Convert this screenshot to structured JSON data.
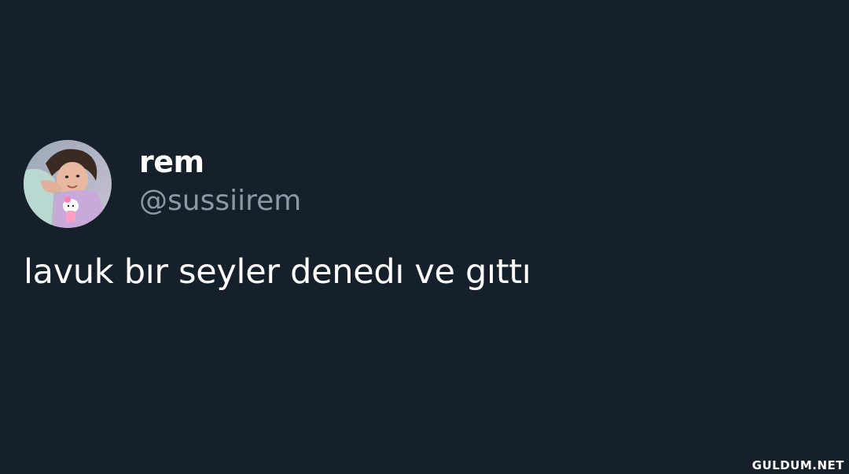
{
  "tweet": {
    "display_name": "rem",
    "handle": "@sussiirem",
    "text": "lavuk bır seyler denedı ve gıttı"
  },
  "watermark": {
    "text": "GULDUM.NET"
  },
  "colors": {
    "background": "#16202a",
    "primary_text": "#ffffff",
    "secondary_text": "#8b98a5"
  },
  "icons": {
    "avatar": "profile-photo"
  }
}
